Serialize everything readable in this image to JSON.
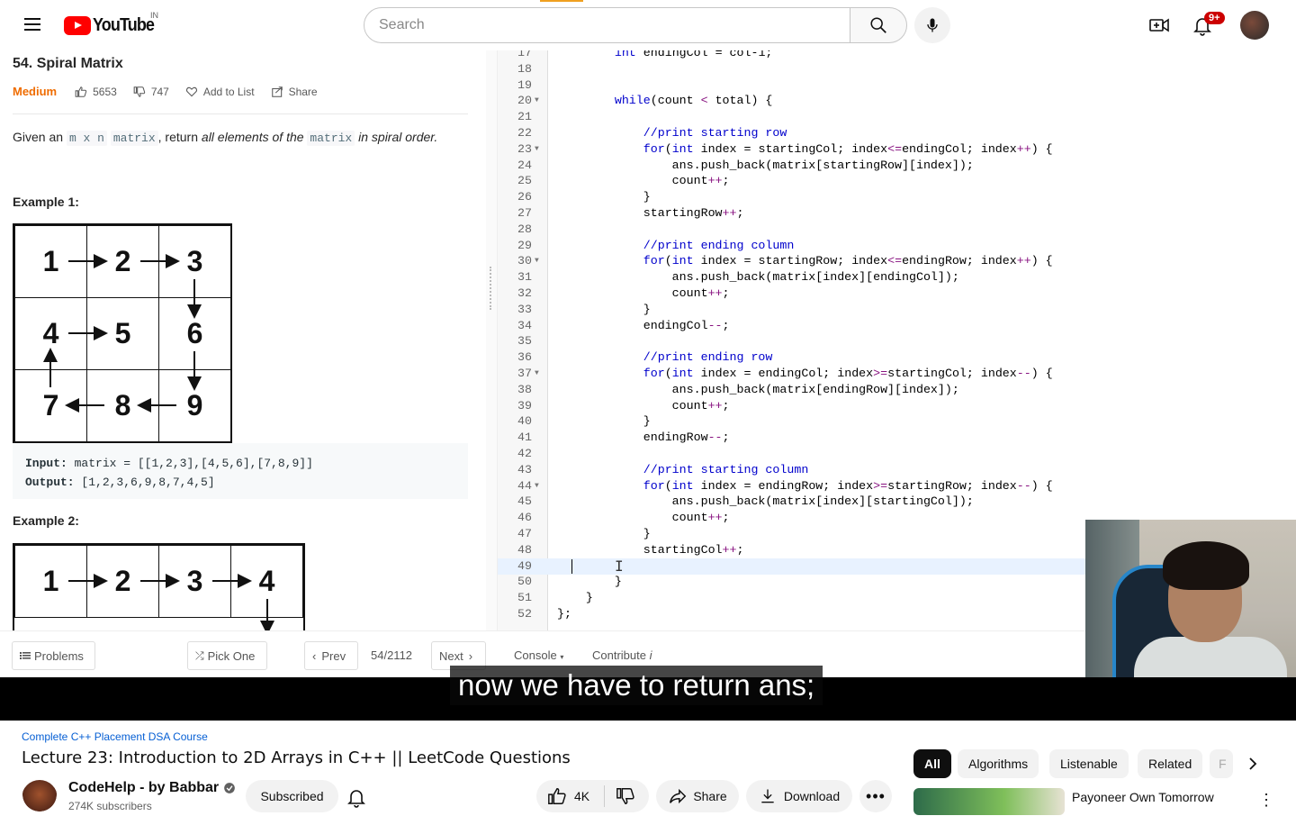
{
  "header": {
    "logo_text": "YouTube",
    "country_code": "IN",
    "search_placeholder": "Search",
    "notifications_badge": "9+"
  },
  "problem": {
    "title": "54. Spiral Matrix",
    "difficulty": "Medium",
    "likes": "5653",
    "dislikes": "747",
    "add_to_list": "Add to List",
    "share": "Share",
    "desc_prefix": "Given an ",
    "desc_code1": "m x n",
    "desc_code2": "matrix",
    "desc_mid": ", return ",
    "desc_italic1": "all elements of the ",
    "desc_code3": "matrix",
    "desc_italic2": " in spiral order.",
    "example1_label": "Example 1:",
    "example1_grid": [
      "1",
      "2",
      "3",
      "4",
      "5",
      "6",
      "7",
      "8",
      "9"
    ],
    "example1_input_label": "Input:",
    "example1_input": "matrix = [[1,2,3],[4,5,6],[7,8,9]]",
    "example1_output_label": "Output:",
    "example1_output": "[1,2,3,6,9,8,7,4,5]",
    "example2_label": "Example 2:",
    "example2_grid": [
      "1",
      "2",
      "3",
      "4"
    ]
  },
  "code_lines": [
    {
      "n": "17",
      "fold": false,
      "text": "        int endingCol = col-1;"
    },
    {
      "n": "18",
      "fold": false,
      "text": ""
    },
    {
      "n": "19",
      "fold": false,
      "text": ""
    },
    {
      "n": "20",
      "fold": true,
      "text": "        while(count < total) {"
    },
    {
      "n": "21",
      "fold": false,
      "text": ""
    },
    {
      "n": "22",
      "fold": false,
      "text": "            //print starting row"
    },
    {
      "n": "23",
      "fold": true,
      "text": "            for(int index = startingCol; index<=endingCol; index++) {"
    },
    {
      "n": "24",
      "fold": false,
      "text": "                ans.push_back(matrix[startingRow][index]);"
    },
    {
      "n": "25",
      "fold": false,
      "text": "                count++;"
    },
    {
      "n": "26",
      "fold": false,
      "text": "            }"
    },
    {
      "n": "27",
      "fold": false,
      "text": "            startingRow++;"
    },
    {
      "n": "28",
      "fold": false,
      "text": ""
    },
    {
      "n": "29",
      "fold": false,
      "text": "            //print ending column"
    },
    {
      "n": "30",
      "fold": true,
      "text": "            for(int index = startingRow; index<=endingRow; index++) {"
    },
    {
      "n": "31",
      "fold": false,
      "text": "                ans.push_back(matrix[index][endingCol]);"
    },
    {
      "n": "32",
      "fold": false,
      "text": "                count++;"
    },
    {
      "n": "33",
      "fold": false,
      "text": "            }"
    },
    {
      "n": "34",
      "fold": false,
      "text": "            endingCol--;"
    },
    {
      "n": "35",
      "fold": false,
      "text": ""
    },
    {
      "n": "36",
      "fold": false,
      "text": "            //print ending row"
    },
    {
      "n": "37",
      "fold": true,
      "text": "            for(int index = endingCol; index>=startingCol; index--) {"
    },
    {
      "n": "38",
      "fold": false,
      "text": "                ans.push_back(matrix[endingRow][index]);"
    },
    {
      "n": "39",
      "fold": false,
      "text": "                count++;"
    },
    {
      "n": "40",
      "fold": false,
      "text": "            }"
    },
    {
      "n": "41",
      "fold": false,
      "text": "            endingRow--;"
    },
    {
      "n": "42",
      "fold": false,
      "text": ""
    },
    {
      "n": "43",
      "fold": false,
      "text": "            //print starting column"
    },
    {
      "n": "44",
      "fold": true,
      "text": "            for(int index = endingRow; index>=startingRow; index--) {"
    },
    {
      "n": "45",
      "fold": false,
      "text": "                ans.push_back(matrix[index][startingCol]);"
    },
    {
      "n": "46",
      "fold": false,
      "text": "                count++;"
    },
    {
      "n": "47",
      "fold": false,
      "text": "            }"
    },
    {
      "n": "48",
      "fold": false,
      "text": "            startingCol++;"
    },
    {
      "n": "49",
      "fold": false,
      "text": ""
    },
    {
      "n": "50",
      "fold": false,
      "text": "        }"
    },
    {
      "n": "51",
      "fold": false,
      "text": "    }"
    },
    {
      "n": "52",
      "fold": false,
      "text": "};"
    }
  ],
  "active_line": "49",
  "lc_toolbar": {
    "problems": "Problems",
    "pick_one": "Pick One",
    "prev": "Prev",
    "counter": "54/2112",
    "next": "Next",
    "console": "Console",
    "contribute": "Contribute"
  },
  "subtitle": "now we have to return ans;",
  "below": {
    "playlist": "Complete C++ Placement DSA Course",
    "title": "Lecture 23: Introduction to 2D Arrays in C++ || LeetCode Questions",
    "channel": "CodeHelp - by Babbar",
    "subscribers": "274K subscribers",
    "subscribed": "Subscribed",
    "likes": "4K",
    "share": "Share",
    "download": "Download",
    "chips": [
      "All",
      "Algorithms",
      "Listenable",
      "Related",
      "F"
    ],
    "rec_title": "Payoneer Own Tomorrow"
  }
}
